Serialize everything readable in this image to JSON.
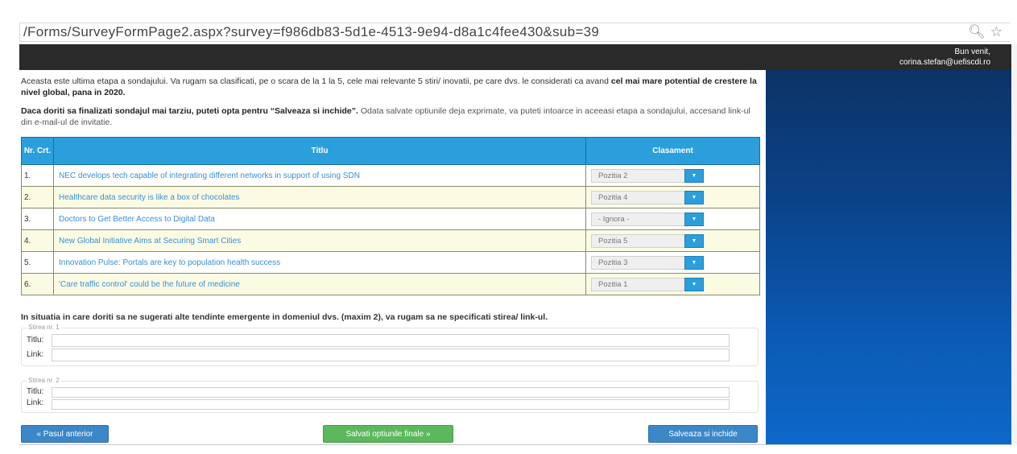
{
  "browser": {
    "url": "/Forms/SurveyFormPage2.aspx?survey=f986db83-5d1e-4513-9e94-d8a1c4fee430&sub=39",
    "icons": [
      "search-icon",
      "star-icon"
    ]
  },
  "header": {
    "welcome": "Bun venit,",
    "user_email": "corina.stefan@uefiscdi.ro"
  },
  "intro": {
    "line1_text": "Aceasta este ultima etapa a sondajului. Va rugam sa clasificati, pe o scara de la 1 la 5, cele mai relevante 5 stiri/ inovatii, pe care dvs. le considerati ca avand",
    "line1_bold": "cel mai mare potential de crestere la nivel global, pana in 2020.",
    "line2_bold": "Daca doriti sa finalizati sondajul mai tarziu, puteti opta pentru “Salveaza si inchide”.",
    "line2_text": " Odata salvate optiunile deja exprimate, va puteti intoarce in aceeasi etapa a sondajului, accesand link-ul din e-mail-ul de invitatie."
  },
  "table": {
    "headers": {
      "nr": "Nr. Crt.",
      "title": "Titlu",
      "rank": "Clasament"
    },
    "rows": [
      {
        "nr": "1.",
        "title": "NEC develops tech capable of integrating different networks in support of using SDN",
        "rank": "Pozitia 2"
      },
      {
        "nr": "2.",
        "title": "Healthcare data security is like a box of chocolates",
        "rank": "Pozitia 4"
      },
      {
        "nr": "3.",
        "title": "Doctors to Get Better Access to Digital Data",
        "rank": "- Ignora -"
      },
      {
        "nr": "4.",
        "title": "New Global Initiative Aims at Securing Smart Cities",
        "rank": "Pozitia 5"
      },
      {
        "nr": "5.",
        "title": "Innovation Pulse: Portals are key to population health success",
        "rank": "Pozitia 3"
      },
      {
        "nr": "6.",
        "title": "'Care traffic control' could be the future of medicine",
        "rank": "Pozitia 1"
      }
    ]
  },
  "suggestions": {
    "heading": "In situatia in care doriti sa ne sugerati alte tendinte emergente in domeniul dvs. (maxim 2), va rugam sa ne specificati stirea/ link-ul.",
    "items": [
      {
        "legend": "Stirea nr. 1",
        "title_label": "Titlu:",
        "link_label": "Link:",
        "title_value": "",
        "link_value": ""
      },
      {
        "legend": "Stirea nr. 2",
        "title_label": "Titlu:",
        "link_label": "Link:",
        "title_value": "",
        "link_value": ""
      }
    ]
  },
  "buttons": {
    "prev": "« Pasul anterior",
    "save": "Salvati optiunile finale »",
    "save_close": "Salveaza si inchide"
  },
  "colors": {
    "table_header": "#2b9fdc",
    "row_alt": "#fbfbe4",
    "link": "#3a8fd0",
    "btn_blue": "#3c87c7",
    "btn_green": "#5cb85c",
    "topbar": "#2a2a2a",
    "panel_top": "#0c3367",
    "panel_bottom": "#0d69c9"
  }
}
